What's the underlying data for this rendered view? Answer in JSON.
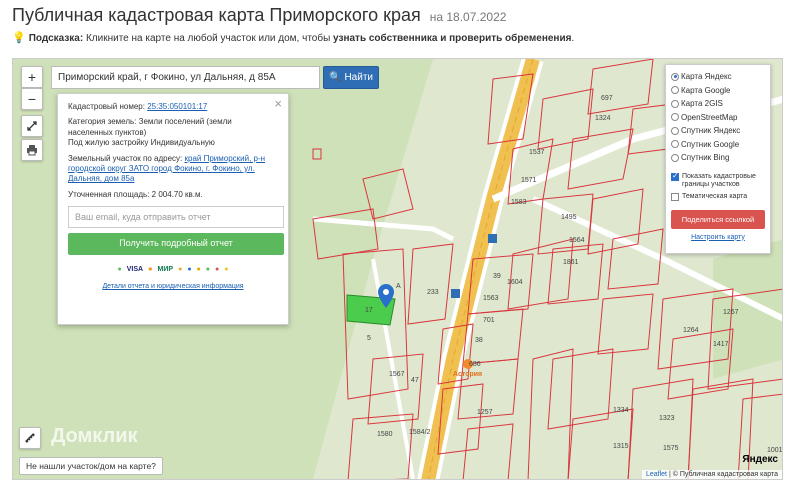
{
  "page": {
    "title": "Публичная кадастровая карта Приморского края",
    "date": "на 18.07.2022",
    "hint_label": "Подсказка:",
    "hint_text": "Кликните на карте на любой участок или дом, чтобы",
    "hint_bold": "узнать собственника и проверить обременения",
    "hint_end": "."
  },
  "map": {
    "search_value": "Приморский край, г Фокино, ул Дальняя, д 85А",
    "find_label": "Найти",
    "zoom_in": "+",
    "zoom_out": "−",
    "not_found": "Не нашли участок/дом на карте?",
    "watermark": "Домклик",
    "attribution_leaflet": "Leaflet",
    "attribution_text": "| © Публичная кадастровая карта",
    "yandex_logo": "Яндекс",
    "parcel_labels": [
      "17",
      "5",
      "233",
      "39",
      "1563",
      "701",
      "38",
      "1604",
      "1567",
      "47",
      "1580",
      "1584/2",
      "1257",
      "697",
      "1324",
      "1537",
      "1571",
      "1583",
      "1495",
      "1564",
      "1861",
      "1267",
      "1264",
      "1417",
      "1323",
      "1334",
      "1001",
      "1315",
      "1575",
      "686",
      "А"
    ],
    "poi_label": "Астория",
    "icons": [
      "zoom-in-icon",
      "zoom-out-icon",
      "fullscreen-icon",
      "print-icon",
      "ruler-icon",
      "map-pin-icon",
      "search-icon"
    ]
  },
  "info": {
    "cad_label": "Кадастровый номер:",
    "cad_value": "25:35:050101:17",
    "cat_label": "Категория земель:",
    "cat_value": "Земли поселений (земли населенных пунктов)",
    "use_value": "Под жилую застройку Индивидуальную",
    "addr_label": "Земельный участок по адресу:",
    "addr_value": "край Приморский, р-н городской округ ЗАТО город Фокино, г. Фокино, ул. Дальняя, дом 85а",
    "area_label": "Уточненная площадь:",
    "area_value": "2 004.70 кв.м.",
    "email_placeholder": "Ваш email, куда отправить отчет",
    "order_label": "Получить подробный отчет",
    "payments": [
      "VISA",
      "МИР"
    ],
    "details_link": "Детали отчета и юридическая информация",
    "close": "×"
  },
  "layers": {
    "items": [
      {
        "label": "Карта Яндекс",
        "selected": true
      },
      {
        "label": "Карта Google",
        "selected": false
      },
      {
        "label": "Карта 2GIS",
        "selected": false
      },
      {
        "label": "OpenStreetMap",
        "selected": false
      },
      {
        "label": "Спутник Яндекс",
        "selected": false
      },
      {
        "label": "Спутник Google",
        "selected": false
      },
      {
        "label": "Спутник Bing",
        "selected": false
      }
    ],
    "show_borders": "Показать кадастровые границы участков",
    "show_borders_checked": true,
    "thematic": "Тематическая карта",
    "thematic_checked": false,
    "share_label": "Поделиться ссылкой",
    "setup_link": "Настроить карту"
  },
  "colors": {
    "primary": "#2f6db5",
    "success": "#5cb85c",
    "danger": "#d9534f",
    "parcel_line": "#d9363e",
    "selected_parcel": "#4ccc4c",
    "road": "#f0c050"
  }
}
